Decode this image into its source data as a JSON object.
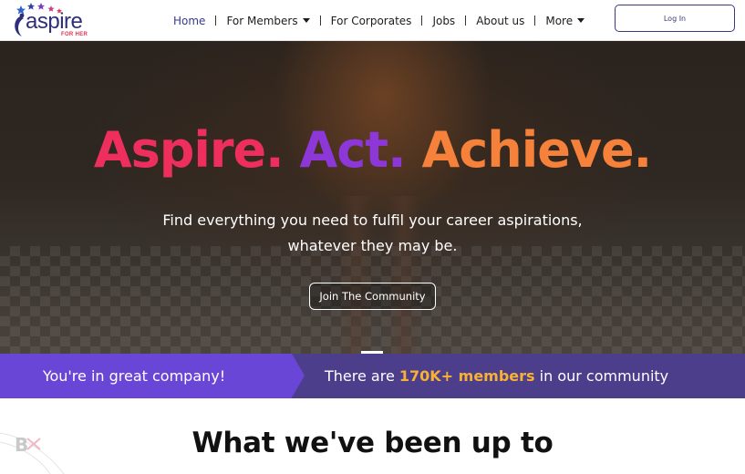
{
  "header": {
    "logo_text": "aspire",
    "logo_subtext": "FOR HER",
    "nav": [
      {
        "label": "Home",
        "active": true,
        "has_dropdown": false
      },
      {
        "label": "For Members",
        "active": false,
        "has_dropdown": true
      },
      {
        "label": "For Corporates",
        "active": false,
        "has_dropdown": false
      },
      {
        "label": "Jobs",
        "active": false,
        "has_dropdown": false
      },
      {
        "label": "About us",
        "active": false,
        "has_dropdown": false
      },
      {
        "label": "More",
        "active": false,
        "has_dropdown": true
      }
    ],
    "login_label": "Log In"
  },
  "hero": {
    "title_word_1": "Aspire.",
    "title_word_2": "Act.",
    "title_word_3": "Achieve.",
    "subtitle_line_1": "Find everything you need to fulfil your career aspirations,",
    "subtitle_line_2": "whatever they may be.",
    "cta_label": "Join The Community"
  },
  "banner": {
    "left_text": "You're in great company!",
    "right_prefix": "There are ",
    "right_highlight": "170K+ members",
    "right_suffix": " in our community"
  },
  "section": {
    "title": "What we've been up to",
    "watermark": "B"
  },
  "colors": {
    "brand_navy": "#2d2f7a",
    "title_pink": "#ee2f5d",
    "title_purple": "#8e37d8",
    "title_orange": "#f5813a",
    "banner_left": "#6a46d6",
    "banner_right": "#4d3e8c",
    "highlight": "#f7b233"
  }
}
